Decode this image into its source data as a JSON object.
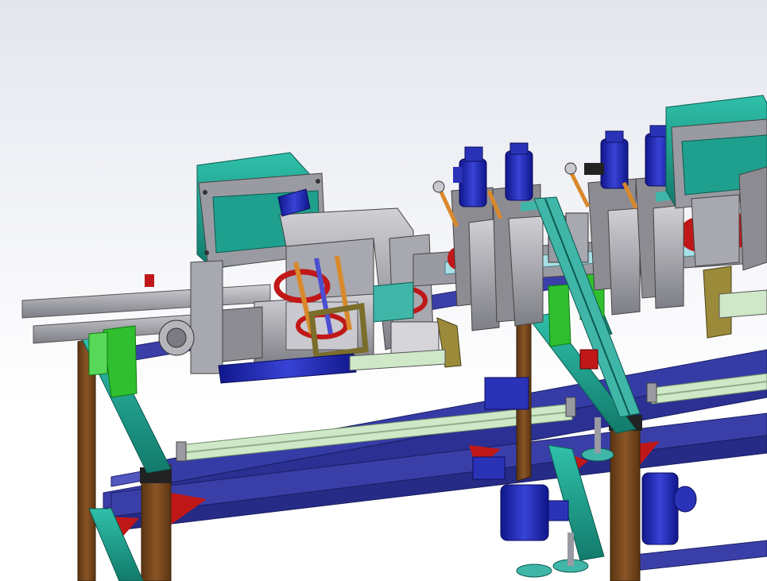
{
  "scene": {
    "description_visible_text": "",
    "colors": {
      "background_top": "#e3e6ee",
      "background_bottom": "#ffffff",
      "frame_wood": "#7a4a1e",
      "frame_wood_dark": "#4d2d10",
      "rail_blue": "#3a3fa8",
      "rail_blue_dark": "#1f2370",
      "rail_teal": "#3fb6a8",
      "rail_light": "#cfe8c8",
      "motor_teal": "#1fa08e",
      "motor_teal_dark": "#10695d",
      "steel_gray": "#8c8c92",
      "steel_light": "#c9c9cf",
      "motor_blue": "#1c27a6",
      "bracket_red": "#c01818",
      "guard_green": "#2fbf2f",
      "bracket_olive": "#7b6d2a",
      "rod_orange": "#d9892b"
    }
  }
}
